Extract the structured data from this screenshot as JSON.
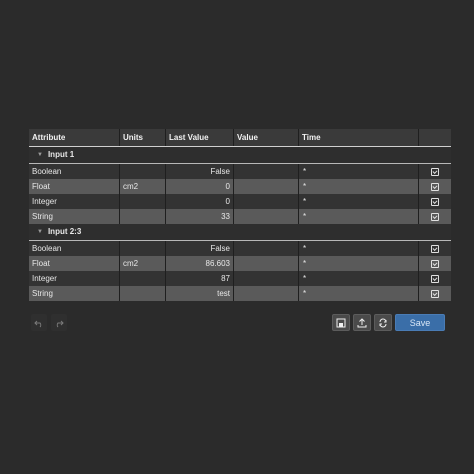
{
  "table": {
    "headers": {
      "attribute": "Attribute",
      "units": "Units",
      "last_value": "Last Value",
      "value": "Value",
      "time": "Time"
    },
    "groups": [
      {
        "name": "Input 1",
        "rows": [
          {
            "attribute": "Boolean",
            "units": "",
            "last_value": "False",
            "value": "",
            "time": "*"
          },
          {
            "attribute": "Float",
            "units": "cm2",
            "last_value": "0",
            "value": "",
            "time": "*"
          },
          {
            "attribute": "Integer",
            "units": "",
            "last_value": "0",
            "value": "",
            "time": "*"
          },
          {
            "attribute": "String",
            "units": "",
            "last_value": "33",
            "value": "",
            "time": "*"
          }
        ]
      },
      {
        "name": "Input 2:3",
        "rows": [
          {
            "attribute": "Boolean",
            "units": "",
            "last_value": "False",
            "value": "",
            "time": "*"
          },
          {
            "attribute": "Float",
            "units": "cm2",
            "last_value": "86.603",
            "value": "",
            "time": "*"
          },
          {
            "attribute": "Integer",
            "units": "",
            "last_value": "87",
            "value": "",
            "time": "*"
          },
          {
            "attribute": "String",
            "units": "",
            "last_value": "test",
            "value": "",
            "time": "*"
          }
        ]
      }
    ]
  },
  "toolbar": {
    "save_label": "Save",
    "icons": [
      "undo-icon",
      "redo-icon",
      "save-to-file-icon",
      "upload-icon",
      "refresh-icon"
    ],
    "accent": "#3a6ea8"
  }
}
